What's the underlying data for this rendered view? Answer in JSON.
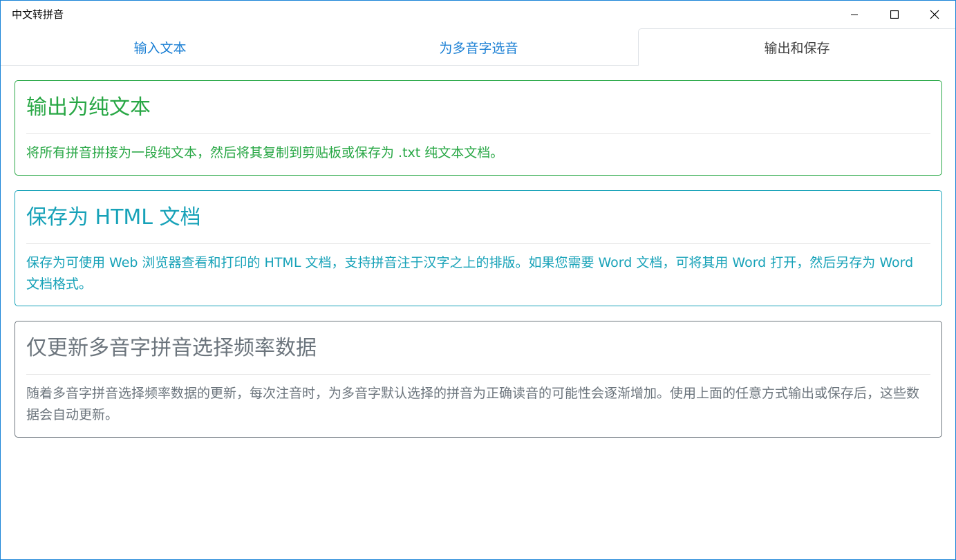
{
  "window": {
    "title": "中文转拼音"
  },
  "tabs": [
    {
      "label": "输入文本",
      "active": false
    },
    {
      "label": "为多音字选音",
      "active": false
    },
    {
      "label": "输出和保存",
      "active": true
    }
  ],
  "cards": {
    "plain_text": {
      "title": "输出为纯文本",
      "description": "将所有拼音拼接为一段纯文本，然后将其复制到剪贴板或保存为 .txt 纯文本文档。",
      "color": "#28a745"
    },
    "html": {
      "title": "保存为 HTML 文档",
      "description": "保存为可使用 Web 浏览器查看和打印的 HTML 文档，支持拼音注于汉字之上的排版。如果您需要 Word 文档，可将其用 Word 打开，然后另存为 Word 文档格式。",
      "color": "#17a2b8"
    },
    "update_only": {
      "title": "仅更新多音字拼音选择频率数据",
      "description": "随着多音字拼音选择频率数据的更新，每次注音时，为多音字默认选择的拼音为正确读音的可能性会逐渐增加。使用上面的任意方式输出或保存后，这些数据会自动更新。",
      "color": "#6c757d"
    }
  },
  "colors": {
    "tab_link": "#1a7fd4",
    "tab_active_text": "#404040",
    "window_border": "#1883d7"
  }
}
